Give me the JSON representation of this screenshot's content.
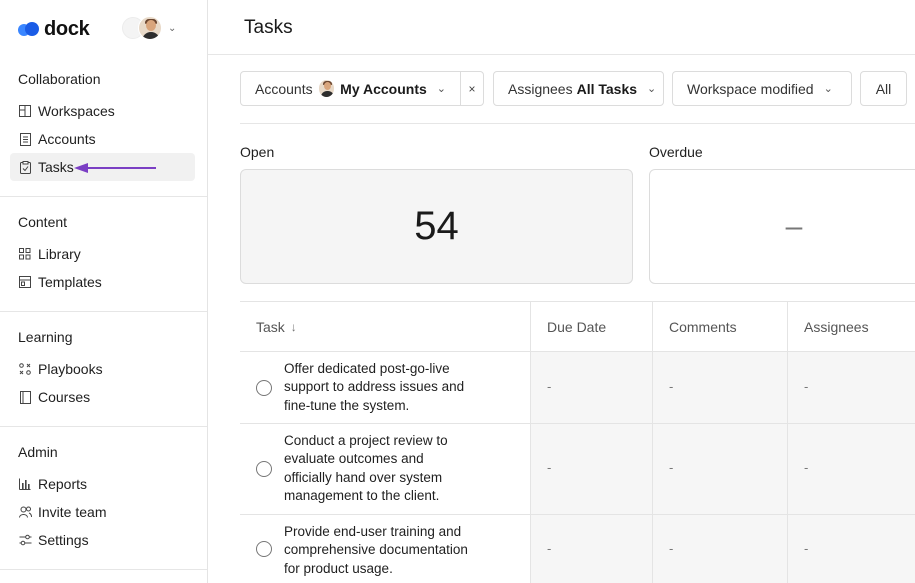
{
  "brand": {
    "name": "dock"
  },
  "sidebar": {
    "sections": [
      {
        "heading": "Collaboration",
        "items": [
          "Workspaces",
          "Accounts",
          "Tasks"
        ]
      },
      {
        "heading": "Content",
        "items": [
          "Library",
          "Templates"
        ]
      },
      {
        "heading": "Learning",
        "items": [
          "Playbooks",
          "Courses"
        ]
      },
      {
        "heading": "Admin",
        "items": [
          "Reports",
          "Invite team",
          "Settings"
        ]
      }
    ],
    "active_item": "Tasks",
    "annotation_arrow_color": "#7b3fc4"
  },
  "main": {
    "title": "Tasks",
    "filters": {
      "accounts_label": "Accounts",
      "accounts_value": "My Accounts",
      "clear_symbol": "×",
      "assignees_label": "Assignees",
      "assignees_value": "All Tasks",
      "sort_label": "Workspace modified",
      "all_label": "All"
    },
    "stats": {
      "open_label": "Open",
      "open_value": "54",
      "overdue_label": "Overdue",
      "overdue_value": "–"
    },
    "table": {
      "columns": [
        "Task",
        "Due Date",
        "Comments",
        "Assignees"
      ],
      "sort_indicator": "↓",
      "rows": [
        {
          "task_lines": [
            "Offer dedicated post-go-live",
            "support to address issues and",
            "fine-tune the system."
          ],
          "due_date": "-",
          "comments": "-",
          "assignees": "-"
        },
        {
          "task_lines": [
            "Conduct a project review to",
            "evaluate outcomes and",
            "officially hand over system",
            "management to the client."
          ],
          "due_date": "-",
          "comments": "-",
          "assignees": "-"
        },
        {
          "task_lines": [
            "Provide end-user training and",
            "comprehensive documentation",
            "for product usage."
          ],
          "due_date": "-",
          "comments": "-",
          "assignees": "-"
        }
      ]
    }
  },
  "colors": {
    "accent_blue": "#1a5ce6",
    "active_bg": "#f1f1f1",
    "card_bg": "#f5f5f5"
  }
}
